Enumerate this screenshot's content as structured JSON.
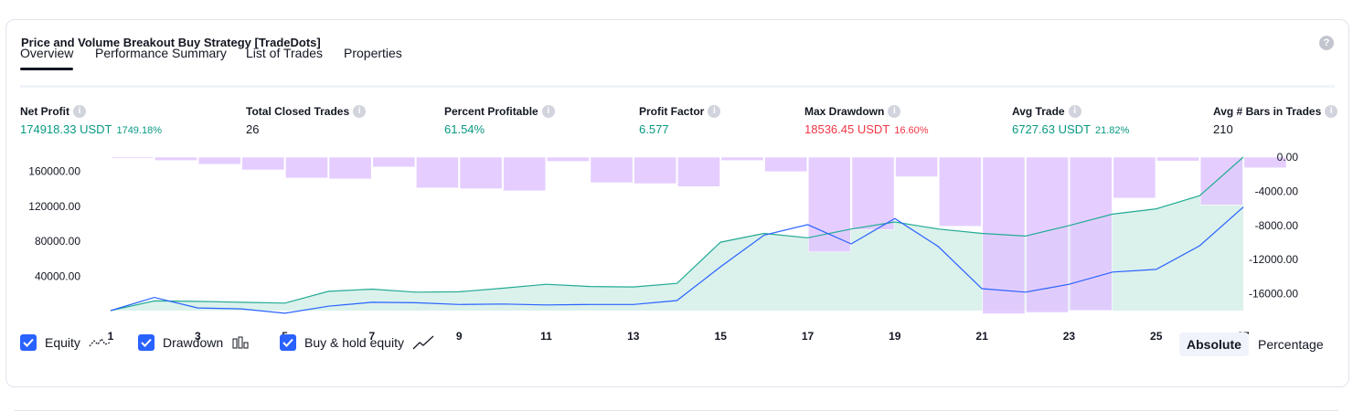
{
  "title": "Price and Volume Breakout Buy Strategy [TradeDots]",
  "help_icon": "?",
  "info_icon": "i",
  "tabs": [
    "Overview",
    "Performance Summary",
    "List of Trades",
    "Properties"
  ],
  "metrics": [
    {
      "label": "Net Profit",
      "value": "174918.33 USDT",
      "pct": "1749.18%",
      "color": "green"
    },
    {
      "label": "Total Closed Trades",
      "value": "26",
      "pct": "",
      "color": "dark"
    },
    {
      "label": "Percent Profitable",
      "value": "61.54%",
      "pct": "",
      "color": "green"
    },
    {
      "label": "Profit Factor",
      "value": "6.577",
      "pct": "",
      "color": "green"
    },
    {
      "label": "Max Drawdown",
      "value": "18536.45 USDT",
      "pct": "16.60%",
      "color": "red"
    },
    {
      "label": "Avg Trade",
      "value": "6727.63 USDT",
      "pct": "21.82%",
      "color": "green"
    },
    {
      "label": "Avg # Bars in Trades",
      "value": "210",
      "pct": "",
      "color": "dark"
    }
  ],
  "legend": [
    {
      "label": "Equity",
      "icon": "equity-line-icon"
    },
    {
      "label": "Drawdown",
      "icon": "drawdown-bars-icon"
    },
    {
      "label": "Buy & hold equity",
      "icon": "buy-hold-line-icon"
    }
  ],
  "toggles": [
    "Absolute",
    "Percentage"
  ],
  "colors": {
    "equity_line": "#22ab94",
    "equity_fill": "#d7f0ea",
    "buy_hold_line": "#2962ff",
    "drawdown_bar": "#e1c6ff",
    "drawdown_bar_over": "#c4b5ef",
    "accent": "#2962ff"
  },
  "chart_data": {
    "type": "line",
    "x": [
      1,
      2,
      3,
      4,
      5,
      6,
      7,
      8,
      9,
      10,
      11,
      12,
      13,
      14,
      15,
      16,
      17,
      18,
      19,
      20,
      21,
      22,
      23,
      24,
      25,
      26,
      27
    ],
    "x_ticks": [
      "1",
      "3",
      "5",
      "7",
      "9",
      "11",
      "13",
      "15",
      "17",
      "19",
      "21",
      "23",
      "25",
      "27"
    ],
    "left_axis": {
      "ticks": [
        "40000.00",
        "80000.00",
        "120000.00",
        "160000.00"
      ],
      "ylim": [
        1000,
        176000
      ]
    },
    "right_axis": {
      "ticks": [
        "0.00",
        "-4000.00",
        "-8000.00",
        "-12000.00",
        "-16000.00"
      ],
      "ylim": [
        -18400,
        0
      ]
    },
    "series": [
      {
        "name": "Equity",
        "values": [
          1000,
          12000,
          11500,
          10500,
          9500,
          23000,
          25500,
          22000,
          22500,
          26500,
          31000,
          28500,
          28000,
          32000,
          79000,
          89000,
          84000,
          94000,
          102000,
          94000,
          89000,
          86000,
          98000,
          111000,
          117000,
          132000,
          176000
        ]
      },
      {
        "name": "Buy & hold equity",
        "values": [
          1000,
          16000,
          4000,
          3000,
          -2000,
          6000,
          10500,
          10000,
          8000,
          8500,
          7500,
          8000,
          8000,
          12500,
          51000,
          87000,
          99000,
          77000,
          106000,
          74000,
          26000,
          22000,
          31000,
          45000,
          48000,
          75000,
          119000
        ]
      },
      {
        "name": "Drawdown",
        "values": [
          -150,
          -400,
          -850,
          -1500,
          -2450,
          -2550,
          -1150,
          -3600,
          -3700,
          -3950,
          -500,
          -3000,
          -3100,
          -3450,
          -400,
          -1700,
          -11100,
          -8500,
          -2300,
          -8100,
          -18350,
          -18200,
          -17950,
          -4800,
          -450,
          -5600,
          -1250
        ]
      }
    ]
  }
}
